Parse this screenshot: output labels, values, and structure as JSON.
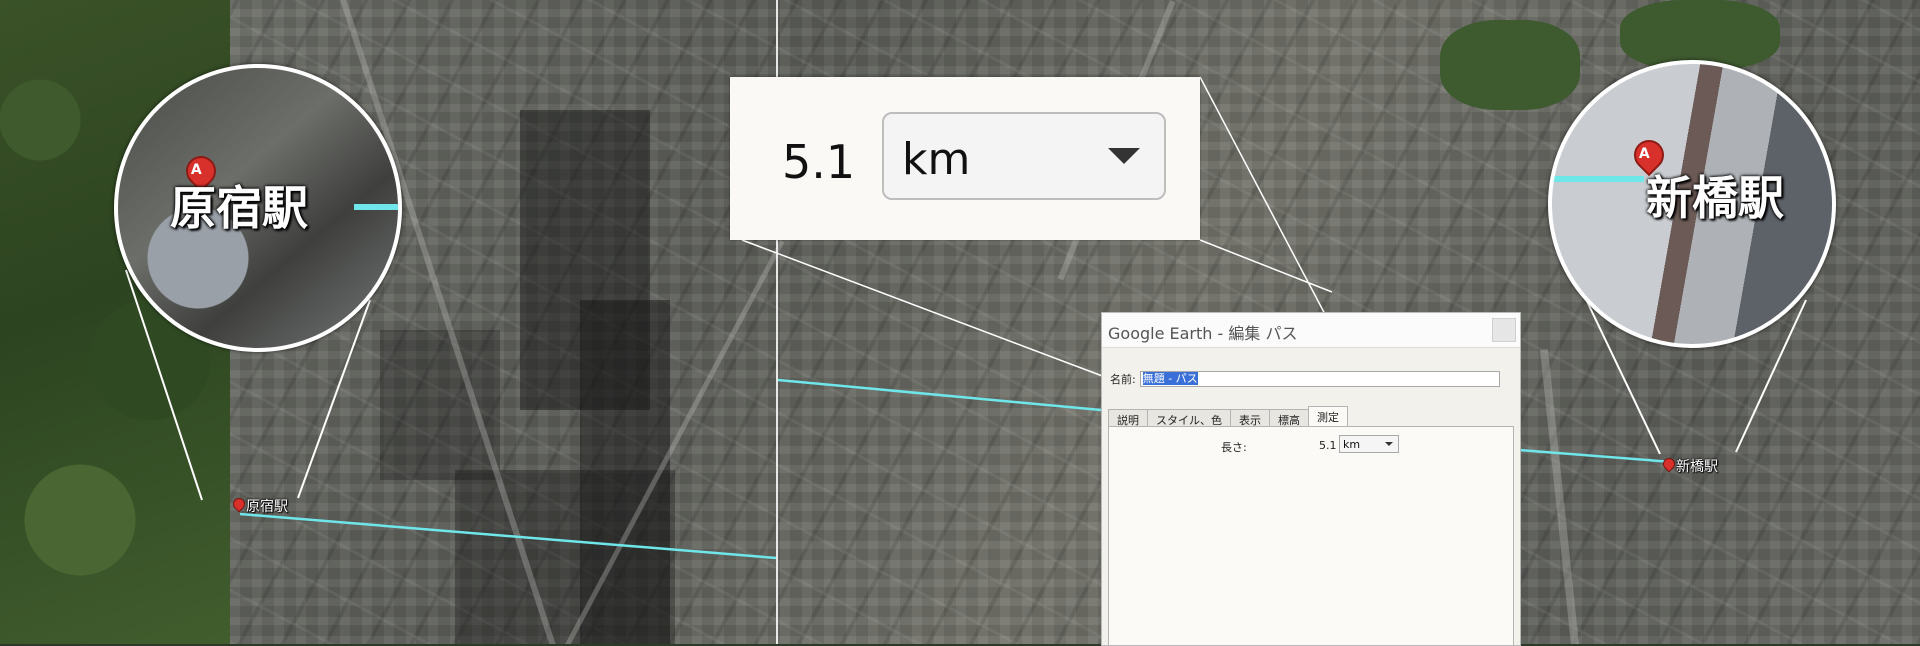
{
  "map": {
    "markers": {
      "harajuku": "原宿駅",
      "shimbashi": "新橋駅"
    },
    "zoom": {
      "left_label": "原宿駅",
      "right_label": "新橋駅",
      "pin_letter": "A"
    },
    "path_color": "#6fe6ea"
  },
  "inset": {
    "value": "5.1",
    "unit": "km"
  },
  "dialog": {
    "title": "Google Earth - 編集 パス",
    "name_label": "名前:",
    "name_value": "無題 - パス",
    "tabs": [
      "説明",
      "スタイル、色",
      "表示",
      "標高",
      "測定"
    ],
    "active_tab": "測定",
    "length_label": "長さ:",
    "length_value": "5.1",
    "length_unit": "km"
  }
}
